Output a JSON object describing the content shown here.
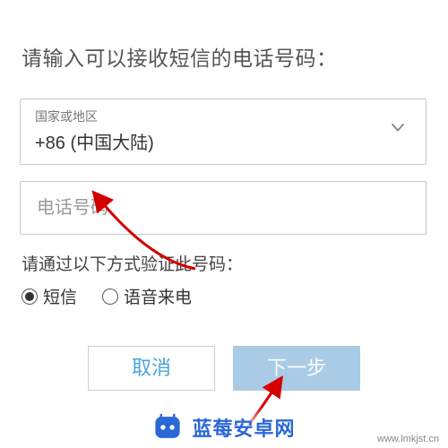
{
  "heading": "请输入可以接收短信的电话号码：",
  "country": {
    "label": "国家或地区",
    "value": "+86 (中国大陆)"
  },
  "phone": {
    "placeholder": "电话号码",
    "value": ""
  },
  "verify": {
    "label": "请通过以下方式验证此号码：",
    "options": {
      "sms": "短信",
      "voice": "语音来电"
    },
    "selected": "sms"
  },
  "buttons": {
    "cancel": "取消",
    "next": "下一步"
  },
  "watermark": {
    "text": "蓝莓安卓网",
    "url": "www.lmkjst.cn"
  }
}
